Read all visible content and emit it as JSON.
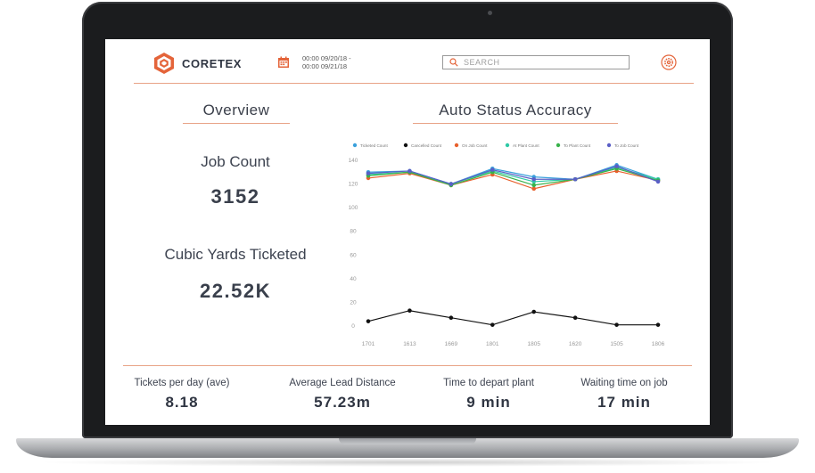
{
  "app": {
    "brand": "CORETEX",
    "date_range_line1": "00:00 09/20/18 -",
    "date_range_line2": "00:00 09/21/18",
    "search_placeholder": "SEARCH"
  },
  "overview": {
    "title": "Overview",
    "job_count_label": "Job Count",
    "job_count_value": "3152",
    "cubic_yards_label": "Cubic Yards Ticketed",
    "cubic_yards_value": "22.52K"
  },
  "kpis": [
    {
      "label": "Tickets per day (ave)",
      "value": "8.18"
    },
    {
      "label": "Average Lead Distance",
      "value": "57.23m"
    },
    {
      "label": "Time to depart plant",
      "value": "9 min"
    },
    {
      "label": "Waiting time on job",
      "value": "17 min"
    }
  ],
  "colors": {
    "accent": "#e8a386",
    "brand": "#e4643a"
  },
  "chart_data": {
    "type": "line",
    "title": "Auto Status Accuracy",
    "categories": [
      "1701",
      "1613",
      "1669",
      "1801",
      "1805",
      "1620",
      "1505",
      "1806"
    ],
    "ylim": [
      0,
      140
    ],
    "yticks": [
      0,
      20,
      40,
      60,
      80,
      100,
      120,
      140
    ],
    "legend_position": "top",
    "series": [
      {
        "name": "Ticketed Count",
        "color": "#3aa0dc",
        "values": [
          130,
          131,
          120,
          133,
          126,
          124,
          136,
          124
        ]
      },
      {
        "name": "Cancelled Count",
        "color": "#111111",
        "values": [
          4,
          13,
          7,
          1,
          12,
          7,
          1,
          1
        ]
      },
      {
        "name": "On Job Count",
        "color": "#e8602c",
        "values": [
          125,
          129,
          119,
          128,
          116,
          124,
          131,
          123
        ]
      },
      {
        "name": "At Plant Count",
        "color": "#2ec9a6",
        "values": [
          128,
          130,
          120,
          131,
          122,
          124,
          134,
          124
        ]
      },
      {
        "name": "To Plant Count",
        "color": "#38b24a",
        "values": [
          127,
          130,
          119,
          130,
          119,
          124,
          133,
          123
        ]
      },
      {
        "name": "To Job Count",
        "color": "#5a5fc6",
        "values": [
          129,
          131,
          120,
          132,
          124,
          124,
          135,
          122
        ]
      }
    ]
  }
}
